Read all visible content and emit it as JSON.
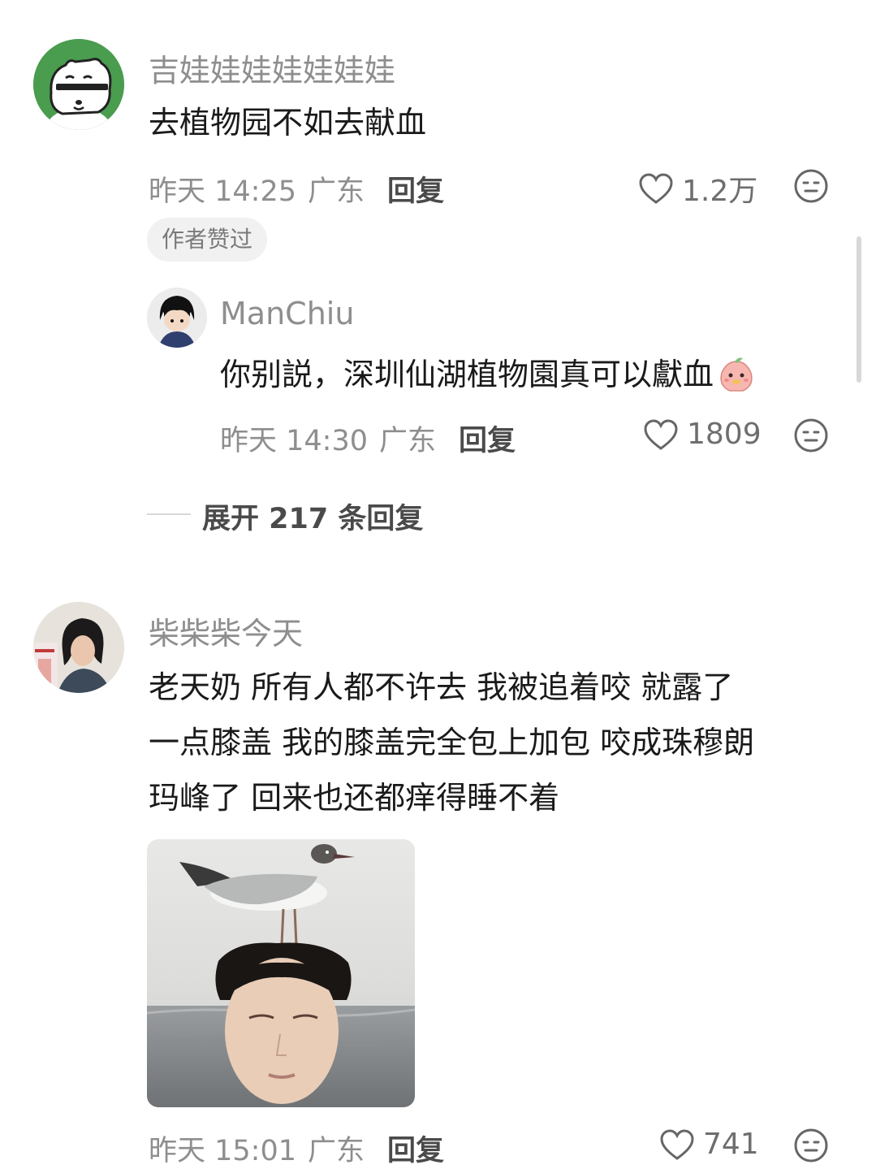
{
  "comments": [
    {
      "username": "吉娃娃娃娃娃娃娃",
      "text": "去植物园不如去献血",
      "time": "昨天 14:25",
      "location": "广东",
      "reply_label": "回复",
      "likes": "1.2万",
      "badge": "作者赞过",
      "reply": {
        "username": "ManChiu",
        "text": "你别説，深圳仙湖植物園真可以獻血",
        "time": "昨天 14:30",
        "location": "广东",
        "reply_label": "回复",
        "likes": "1809"
      },
      "expand_label": "展开 217 条回复"
    },
    {
      "username": "柴柴柴今天",
      "text_lines": [
        "老天奶 所有人都不许去 我被追着咬 就露了",
        "一点膝盖 我的膝盖完全包上加包 咬成珠穆朗",
        "玛峰了 回来也还都痒得睡不着"
      ],
      "time": "昨天 15:01",
      "location": "广东",
      "reply_label": "回复",
      "likes": "741"
    }
  ],
  "icons": {
    "like": "heart-outline-icon",
    "dislike": "neutral-face-icon"
  },
  "colors": {
    "avatar_bg_green": "#4a9c4f",
    "meta_gray": "#8e8e8e"
  }
}
